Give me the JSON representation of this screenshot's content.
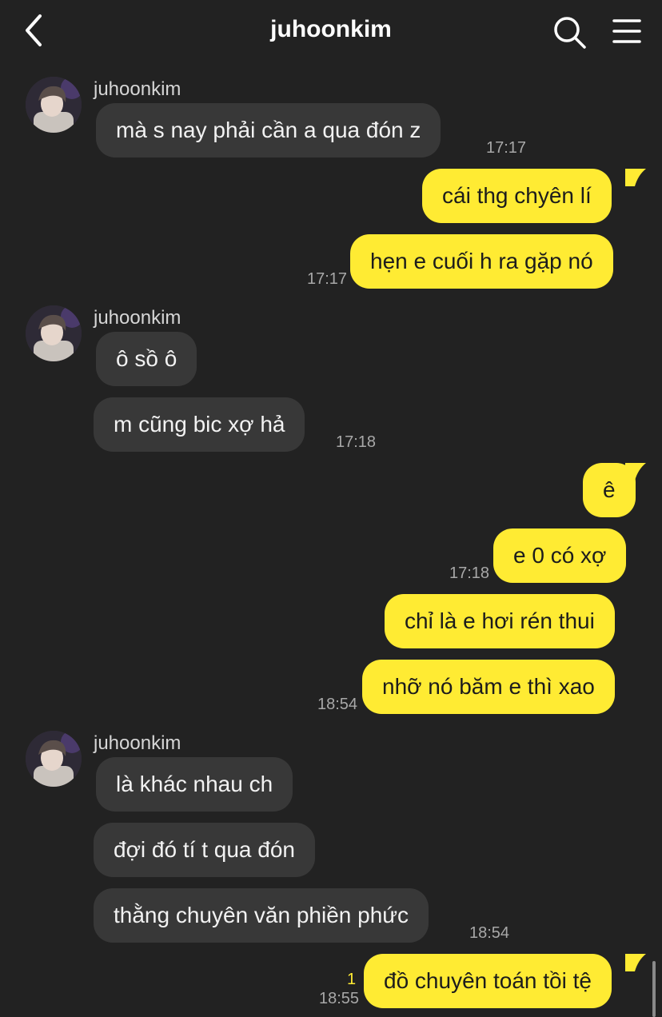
{
  "header": {
    "title": "juhoonkim",
    "icons": {
      "back": "chevron-left-icon",
      "search": "search-icon",
      "menu": "menu-icon"
    }
  },
  "colors": {
    "background": "#222222",
    "incoming_bubble": "#383838",
    "outgoing_bubble": "#ffeb33",
    "timestamp": "#a8a8a8",
    "unread": "#ffeb33"
  },
  "messages": {
    "g1_name": "juhoonkim",
    "g1_m1": "mà s nay phải cần a qua đón z",
    "g1_t1": "17:17",
    "o1_m1": "cái thg chyên lí",
    "o1_m2": "hẹn e cuối h ra gặp nó",
    "o1_t1": "17:17",
    "g2_name": "juhoonkim",
    "g2_m1": "ô sồ ô",
    "g2_m2": "m cũng bic xợ hả",
    "g2_t1": "17:18",
    "o2_m1": "ê",
    "o2_m2": "e 0 có xợ",
    "o2_t1": "17:18",
    "o2_m3": "chỉ là e hơi rén thui",
    "o2_m4": "nhỡ nó băm e thì xao",
    "o2_t2": "18:54",
    "g3_name": "juhoonkim",
    "g3_m1": "là khác nhau ch",
    "g3_m2": "đợi đó tí t qua đón",
    "g3_m3": "thằng chuyên văn phiền phức",
    "g3_t1": "18:54",
    "o3_m1": "đồ chuyên toán tồi tệ",
    "o3_unread": "1",
    "o3_t1": "18:55"
  }
}
